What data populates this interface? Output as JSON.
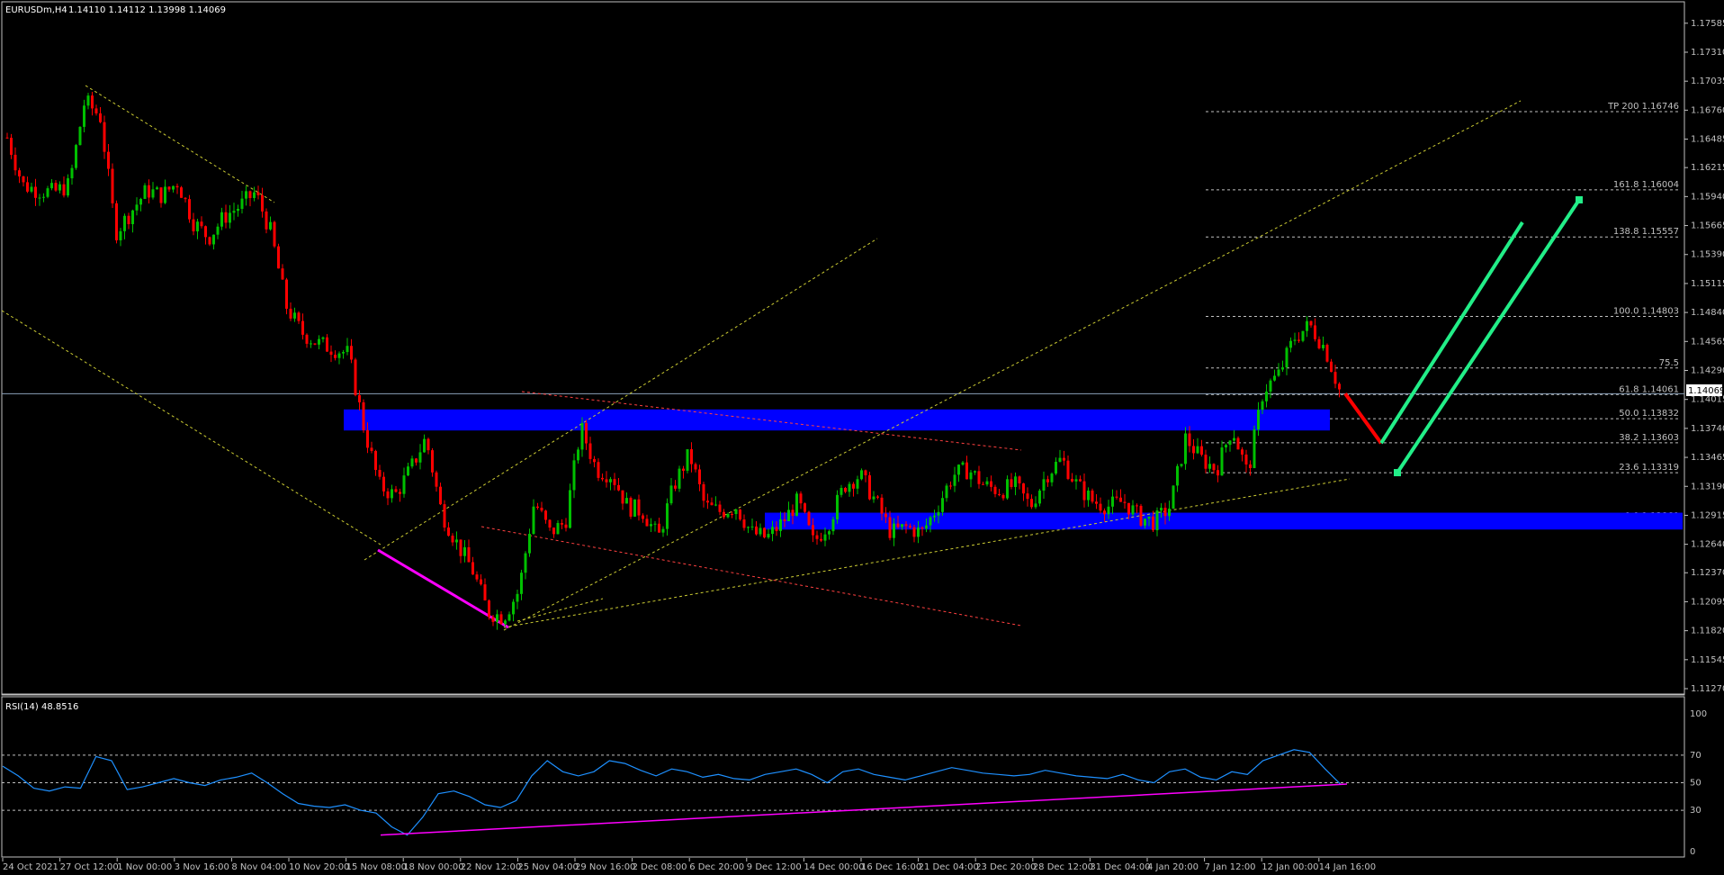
{
  "header": {
    "symbol_timeframe": "EURUSDm,H4",
    "ohlc": "1.14110 1.14112 1.13998 1.14069"
  },
  "rsi_panel": {
    "label": "RSI(14) 48.8516",
    "levels": [
      "100",
      "70",
      "50",
      "30",
      "0"
    ]
  },
  "price_axis": {
    "ticks": [
      "1.17585",
      "1.17310",
      "1.17035",
      "1.16760",
      "1.16485",
      "1.16215",
      "1.15940",
      "1.15665",
      "1.15390",
      "1.15115",
      "1.14840",
      "1.14565",
      "1.14290",
      "1.14015",
      "1.13740",
      "1.13465",
      "1.13190",
      "1.12915",
      "1.12640",
      "1.12370",
      "1.12095",
      "1.11820",
      "1.11545",
      "1.11270"
    ],
    "current_price_tag": "1.14069"
  },
  "time_axis": {
    "ticks": [
      "24 Oct 2021",
      "27 Oct 12:00",
      "1 Nov 00:00",
      "3 Nov 16:00",
      "8 Nov 04:00",
      "10 Nov 20:00",
      "15 Nov 08:00",
      "18 Nov 00:00",
      "22 Nov 12:00",
      "25 Nov 04:00",
      "29 Nov 16:00",
      "2 Dec 08:00",
      "6 Dec 20:00",
      "9 Dec 12:00",
      "14 Dec 00:00",
      "16 Dec 16:00",
      "21 Dec 04:00",
      "23 Dec 20:00",
      "28 Dec 12:00",
      "31 Dec 04:00",
      "4 Jan 20:00",
      "7 Jan 12:00",
      "12 Jan 00:00",
      "14 Jan 16:00"
    ]
  },
  "fib_levels": [
    {
      "label": "TP 200 1.16746",
      "price": 1.16746
    },
    {
      "label": "161.8 1.16004",
      "price": 1.16004
    },
    {
      "label": "138.8 1.15557",
      "price": 1.15557
    },
    {
      "label": "100.0 1.14803",
      "price": 1.14803
    },
    {
      "label": "75.5",
      "price": 1.14313
    },
    {
      "label": "61.8 1.14061",
      "price": 1.14061
    },
    {
      "label": "50.0 1.13832",
      "price": 1.13832
    },
    {
      "label": "38.2 1.13603",
      "price": 1.13603
    },
    {
      "label": "23.6 1.13319",
      "price": 1.13319
    },
    {
      "label": "0.0 1.12860",
      "price": 1.1286
    }
  ],
  "colors": {
    "background": "#000000",
    "axis": "#c0c0c0",
    "bull": "#00c000",
    "bear": "#ff0000",
    "zone": "#0000ff",
    "trend_yellow": "#ffff00",
    "channel_red": "#ff0000",
    "divergence": "#ff00ff",
    "projection_green": "#22ee88",
    "rsi_line": "#1e90ff"
  },
  "chart_data": [
    {
      "type": "candlestick",
      "title": "EURUSDm,H4",
      "ylim": [
        1.1127,
        1.1772
      ],
      "x_labels": [
        "24 Oct 2021",
        "27 Oct 12:00",
        "1 Nov 00:00",
        "3 Nov 16:00",
        "8 Nov 04:00",
        "10 Nov 20:00",
        "15 Nov 08:00",
        "18 Nov 00:00",
        "22 Nov 12:00",
        "25 Nov 04:00",
        "29 Nov 16:00",
        "2 Dec 08:00",
        "6 Dec 20:00",
        "9 Dec 12:00",
        "14 Dec 00:00",
        "16 Dec 16:00",
        "21 Dec 04:00",
        "23 Dec 20:00",
        "28 Dec 12:00",
        "31 Dec 04:00",
        "4 Jan 20:00",
        "7 Jan 12:00",
        "12 Jan 00:00",
        "14 Jan 16:00"
      ],
      "price_path": [
        1.165,
        1.1605,
        1.16,
        1.1598,
        1.1605,
        1.1685,
        1.167,
        1.156,
        1.158,
        1.16,
        1.1595,
        1.1608,
        1.157,
        1.1555,
        1.1575,
        1.1585,
        1.1598,
        1.156,
        1.149,
        1.1465,
        1.1455,
        1.145,
        1.1445,
        1.1375,
        1.132,
        1.131,
        1.1335,
        1.1365,
        1.1295,
        1.1265,
        1.124,
        1.12,
        1.1195,
        1.122,
        1.1305,
        1.1275,
        1.1285,
        1.1375,
        1.1335,
        1.133,
        1.13,
        1.1295,
        1.127,
        1.132,
        1.135,
        1.13,
        1.1295,
        1.13,
        1.1275,
        1.127,
        1.1285,
        1.1305,
        1.1265,
        1.1285,
        1.132,
        1.133,
        1.1305,
        1.1275,
        1.128,
        1.1275,
        1.13,
        1.133,
        1.1335,
        1.132,
        1.1315,
        1.132,
        1.13,
        1.133,
        1.1345,
        1.132,
        1.1305,
        1.13,
        1.1305,
        1.129,
        1.1285,
        1.13,
        1.1365,
        1.1345,
        1.1335,
        1.1375,
        1.133,
        1.141,
        1.1425,
        1.146,
        1.1472,
        1.145,
        1.1407
      ],
      "horizontal_line": 1.14069,
      "supply_zone": [
        1.1372,
        1.1392
      ],
      "demand_zone": [
        1.1278,
        1.1294
      ],
      "fib_levels": [
        1.16746,
        1.16004,
        1.15557,
        1.14803,
        1.14313,
        1.14061,
        1.13832,
        1.13603,
        1.13319,
        1.1286
      ],
      "projection_path": [
        1.1407,
        1.136,
        1.1332,
        1.158
      ]
    },
    {
      "type": "line",
      "title": "RSI(14) 48.8516",
      "ylim": [
        0,
        100
      ],
      "levels": [
        30,
        50,
        70
      ],
      "values": [
        62,
        55,
        46,
        44,
        47,
        46,
        69,
        66,
        45,
        47,
        50,
        53,
        50,
        48,
        52,
        54,
        57,
        50,
        42,
        35,
        33,
        32,
        34,
        30,
        28,
        18,
        12,
        25,
        42,
        44,
        40,
        34,
        32,
        37,
        55,
        66,
        58,
        55,
        58,
        66,
        64,
        59,
        55,
        60,
        58,
        54,
        56,
        53,
        52,
        56,
        58,
        60,
        56,
        50,
        58,
        60,
        56,
        54,
        52,
        55,
        58,
        61,
        59,
        57,
        56,
        55,
        56,
        59,
        57,
        55,
        54,
        53,
        56,
        52,
        50,
        58,
        60,
        54,
        52,
        58,
        56,
        66,
        70,
        74,
        72,
        60,
        48.85
      ]
    }
  ]
}
